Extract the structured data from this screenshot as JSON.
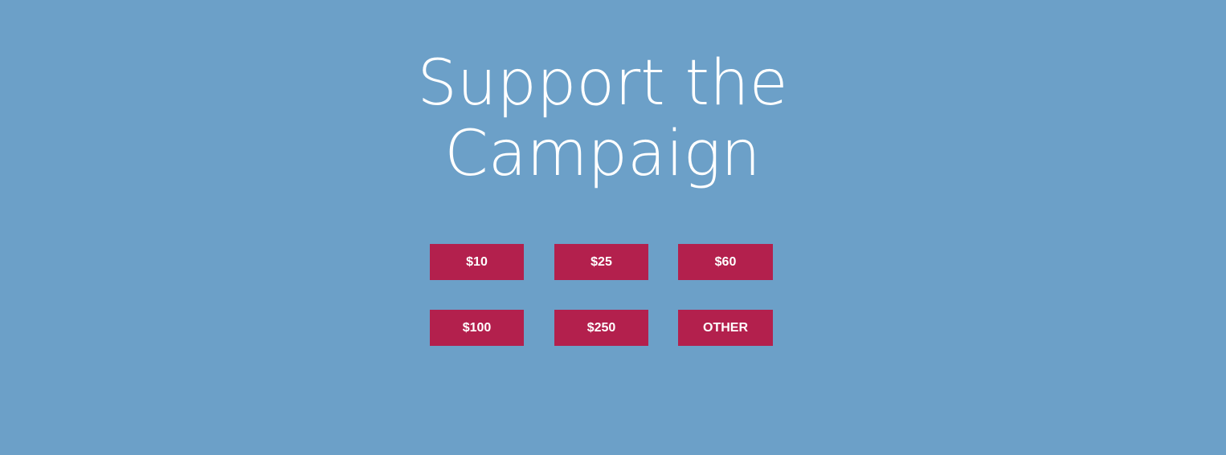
{
  "hero": {
    "title_line_1": "Support the",
    "title_line_2": "Campaign"
  },
  "donation_amounts": [
    {
      "label": "$10"
    },
    {
      "label": "$25"
    },
    {
      "label": "$60"
    },
    {
      "label": "$100"
    },
    {
      "label": "$250"
    },
    {
      "label": "OTHER"
    }
  ],
  "colors": {
    "background": "#6ca0c8",
    "button": "#b3204d",
    "text": "#ffffff"
  }
}
